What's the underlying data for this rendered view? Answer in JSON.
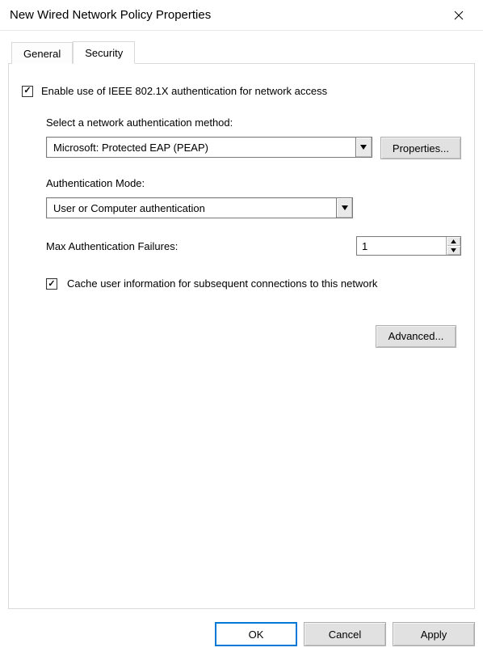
{
  "window": {
    "title": "New Wired Network Policy Properties"
  },
  "tabs": {
    "general": "General",
    "security": "Security"
  },
  "security": {
    "enable_label": "Enable use of IEEE 802.1X authentication for network access",
    "enable_checked": true,
    "auth_method_label": "Select a network authentication method:",
    "auth_method_value": "Microsoft: Protected EAP (PEAP)",
    "properties_button": "Properties...",
    "auth_mode_label": "Authentication Mode:",
    "auth_mode_value": "User or Computer authentication",
    "max_failures_label": "Max Authentication Failures:",
    "max_failures_value": "1",
    "cache_label": "Cache user information for subsequent connections to this network",
    "cache_checked": true,
    "advanced_button": "Advanced..."
  },
  "buttons": {
    "ok": "OK",
    "cancel": "Cancel",
    "apply": "Apply"
  }
}
